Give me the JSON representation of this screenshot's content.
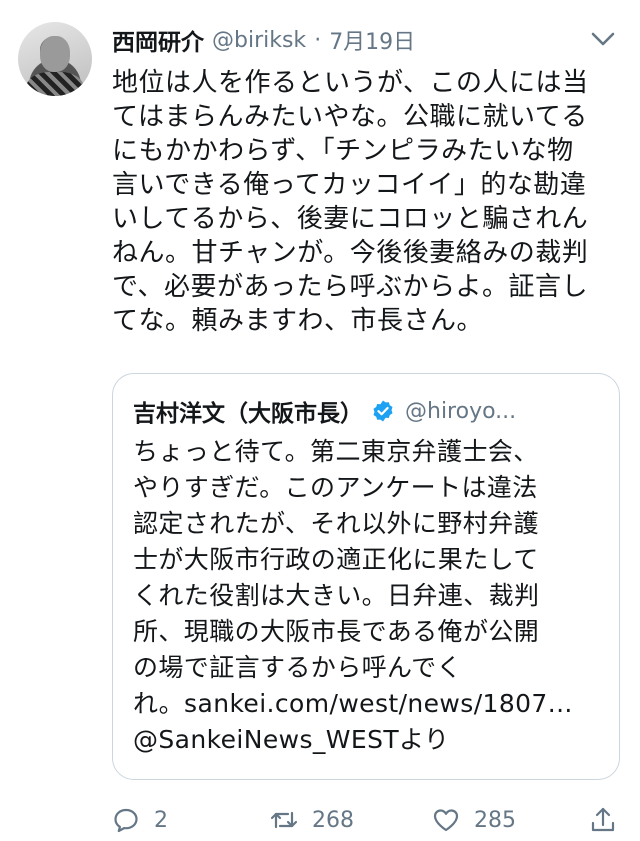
{
  "tweet": {
    "author_name": "西岡研介",
    "handle": "@biriksk",
    "separator": "·",
    "date": "7月19日",
    "body_lines": [
      "地位は人を作るというが、この人には当",
      "てはまらんみたいやな。公職に就いてる",
      "にもかかわらず、「チンピラみたいな物",
      "言いできる俺ってカッコイイ」的な勘違",
      "いしてるから、後妻にコロッと騙されん",
      "ねん。甘チャンが。今後後妻絡みの裁判",
      "で、必要があったら呼ぶからよ。証言し",
      "てな。頼みますわ、市長さん。"
    ]
  },
  "quoted": {
    "author_name": "吉村洋文（大阪市長）",
    "handle": "@hiroyo...",
    "body_lines": [
      "ちょっと待て。第二東京弁護士会、",
      "やりすぎだ。このアンケートは違法",
      "認定されたが、それ以外に野村弁護",
      "士が大阪市行政の適正化に果たして",
      "くれた役割は大きい。日弁連、裁判",
      "所、現職の大阪市長である俺が公開",
      "の場で証言するから呼んでく",
      "れ。sankei.com/west/news/1807...",
      "@SankeiNews_WESTより"
    ]
  },
  "actions": {
    "reply_count": "2",
    "retweet_count": "268",
    "like_count": "285"
  },
  "icons": {
    "caret": "chevron-down-icon",
    "verified": "verified-badge-icon",
    "reply": "reply-icon",
    "retweet": "retweet-icon",
    "like": "heart-icon",
    "share": "share-icon"
  },
  "colors": {
    "text": "#14171a",
    "secondary": "#657786",
    "border": "#ccd6dd",
    "verified": "#1da1f2"
  }
}
